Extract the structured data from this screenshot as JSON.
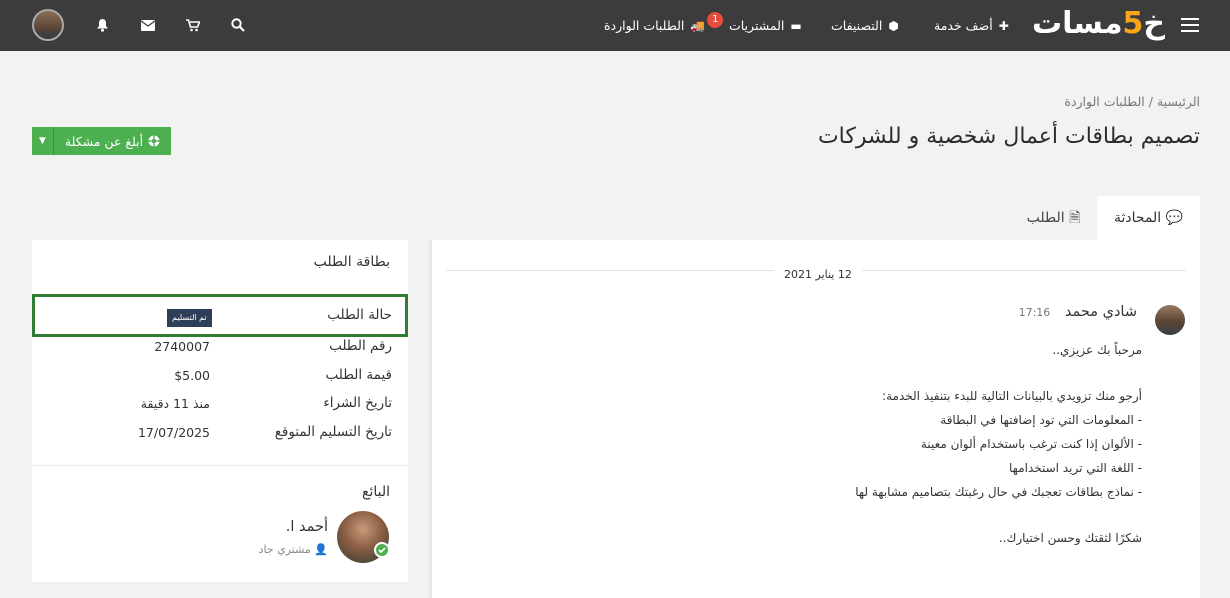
{
  "topbar": {
    "logo_text_a": "خ",
    "logo_text_five": "5",
    "logo_text_b": "مسات",
    "nav": {
      "incoming_orders": "الطلبات الواردة",
      "incoming_badge": "1",
      "purchases": "المشتريات",
      "categories": "التصنيفات",
      "add_service": "أضف خدمة"
    },
    "icons": [
      "menu-icon",
      "truck-icon",
      "folder-icon",
      "cubes-icon",
      "plus-icon",
      "search-icon",
      "cart-icon",
      "envelope-icon",
      "bell-icon"
    ]
  },
  "breadcrumb": {
    "home": "الرئيسية",
    "separator": "/",
    "current": "الطلبات الواردة"
  },
  "page_title": "تصميم بطاقات أعمال شخصية و للشركات",
  "report_button": {
    "label": "أبلغ عن مشكلة"
  },
  "tabs": {
    "conversation": "المحادثة",
    "order": "الطلب"
  },
  "conversation": {
    "date": "12 يناير 2021",
    "message": {
      "author": "شادي محمد",
      "time": "17:16",
      "greeting": "مرحباً بك عزيزي..",
      "intro": "أرجو منك تزويدي بالبيانات التالية للبدء بتنفيذ الخدمة:",
      "line1": "- المعلومات التي تود إضافتها في البطاقة",
      "line2": "- الألوان إذا كنت ترغب باستخدام ألوان معينة",
      "line3": "- اللغة التي تريد استخدامها",
      "line4": "- نماذج بطاقات تعجبك في حال رغبتك بتصاميم مشابهة لها",
      "closing": "شكرًا لثقتك وحسن اختيارك.."
    }
  },
  "order_card": {
    "title": "بطاقة الطلب",
    "status_label": "حالة الطلب",
    "status_value": "تم التسليم",
    "number_label": "رقم الطلب",
    "number_value": "2740007",
    "price_label": "قيمة الطلب",
    "price_value": "$5.00",
    "purchase_date_label": "تاريخ الشراء",
    "purchase_date_value": "منذ 11 دقيقة",
    "delivery_label": "تاريخ التسليم المتوقع",
    "delivery_value": "17/07/2025",
    "seller_title": "البائع",
    "seller_name": "أحمد ا.",
    "seller_level": "مشتري جاد"
  }
}
